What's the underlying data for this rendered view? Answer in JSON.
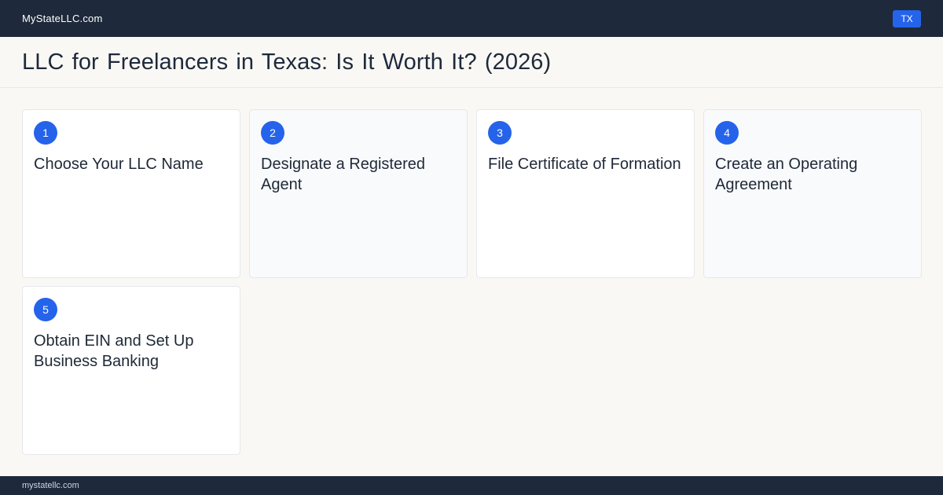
{
  "header": {
    "brand": "MyStateLLC.com",
    "state_badge": "TX"
  },
  "page": {
    "title": "LLC for Freelancers in Texas: Is It Worth It? (2026)"
  },
  "steps": [
    {
      "number": "1",
      "title": "Choose Your LLC Name"
    },
    {
      "number": "2",
      "title": "Designate a Registered Agent"
    },
    {
      "number": "3",
      "title": "File Certificate of Formation"
    },
    {
      "number": "4",
      "title": "Create an Operating Agreement"
    },
    {
      "number": "5",
      "title": "Obtain EIN and Set Up Business Banking"
    }
  ],
  "footer": {
    "domain": "mystatellc.com"
  },
  "colors": {
    "nav_background": "#1e293b",
    "accent": "#2563eb",
    "page_background": "#f9f8f4"
  }
}
